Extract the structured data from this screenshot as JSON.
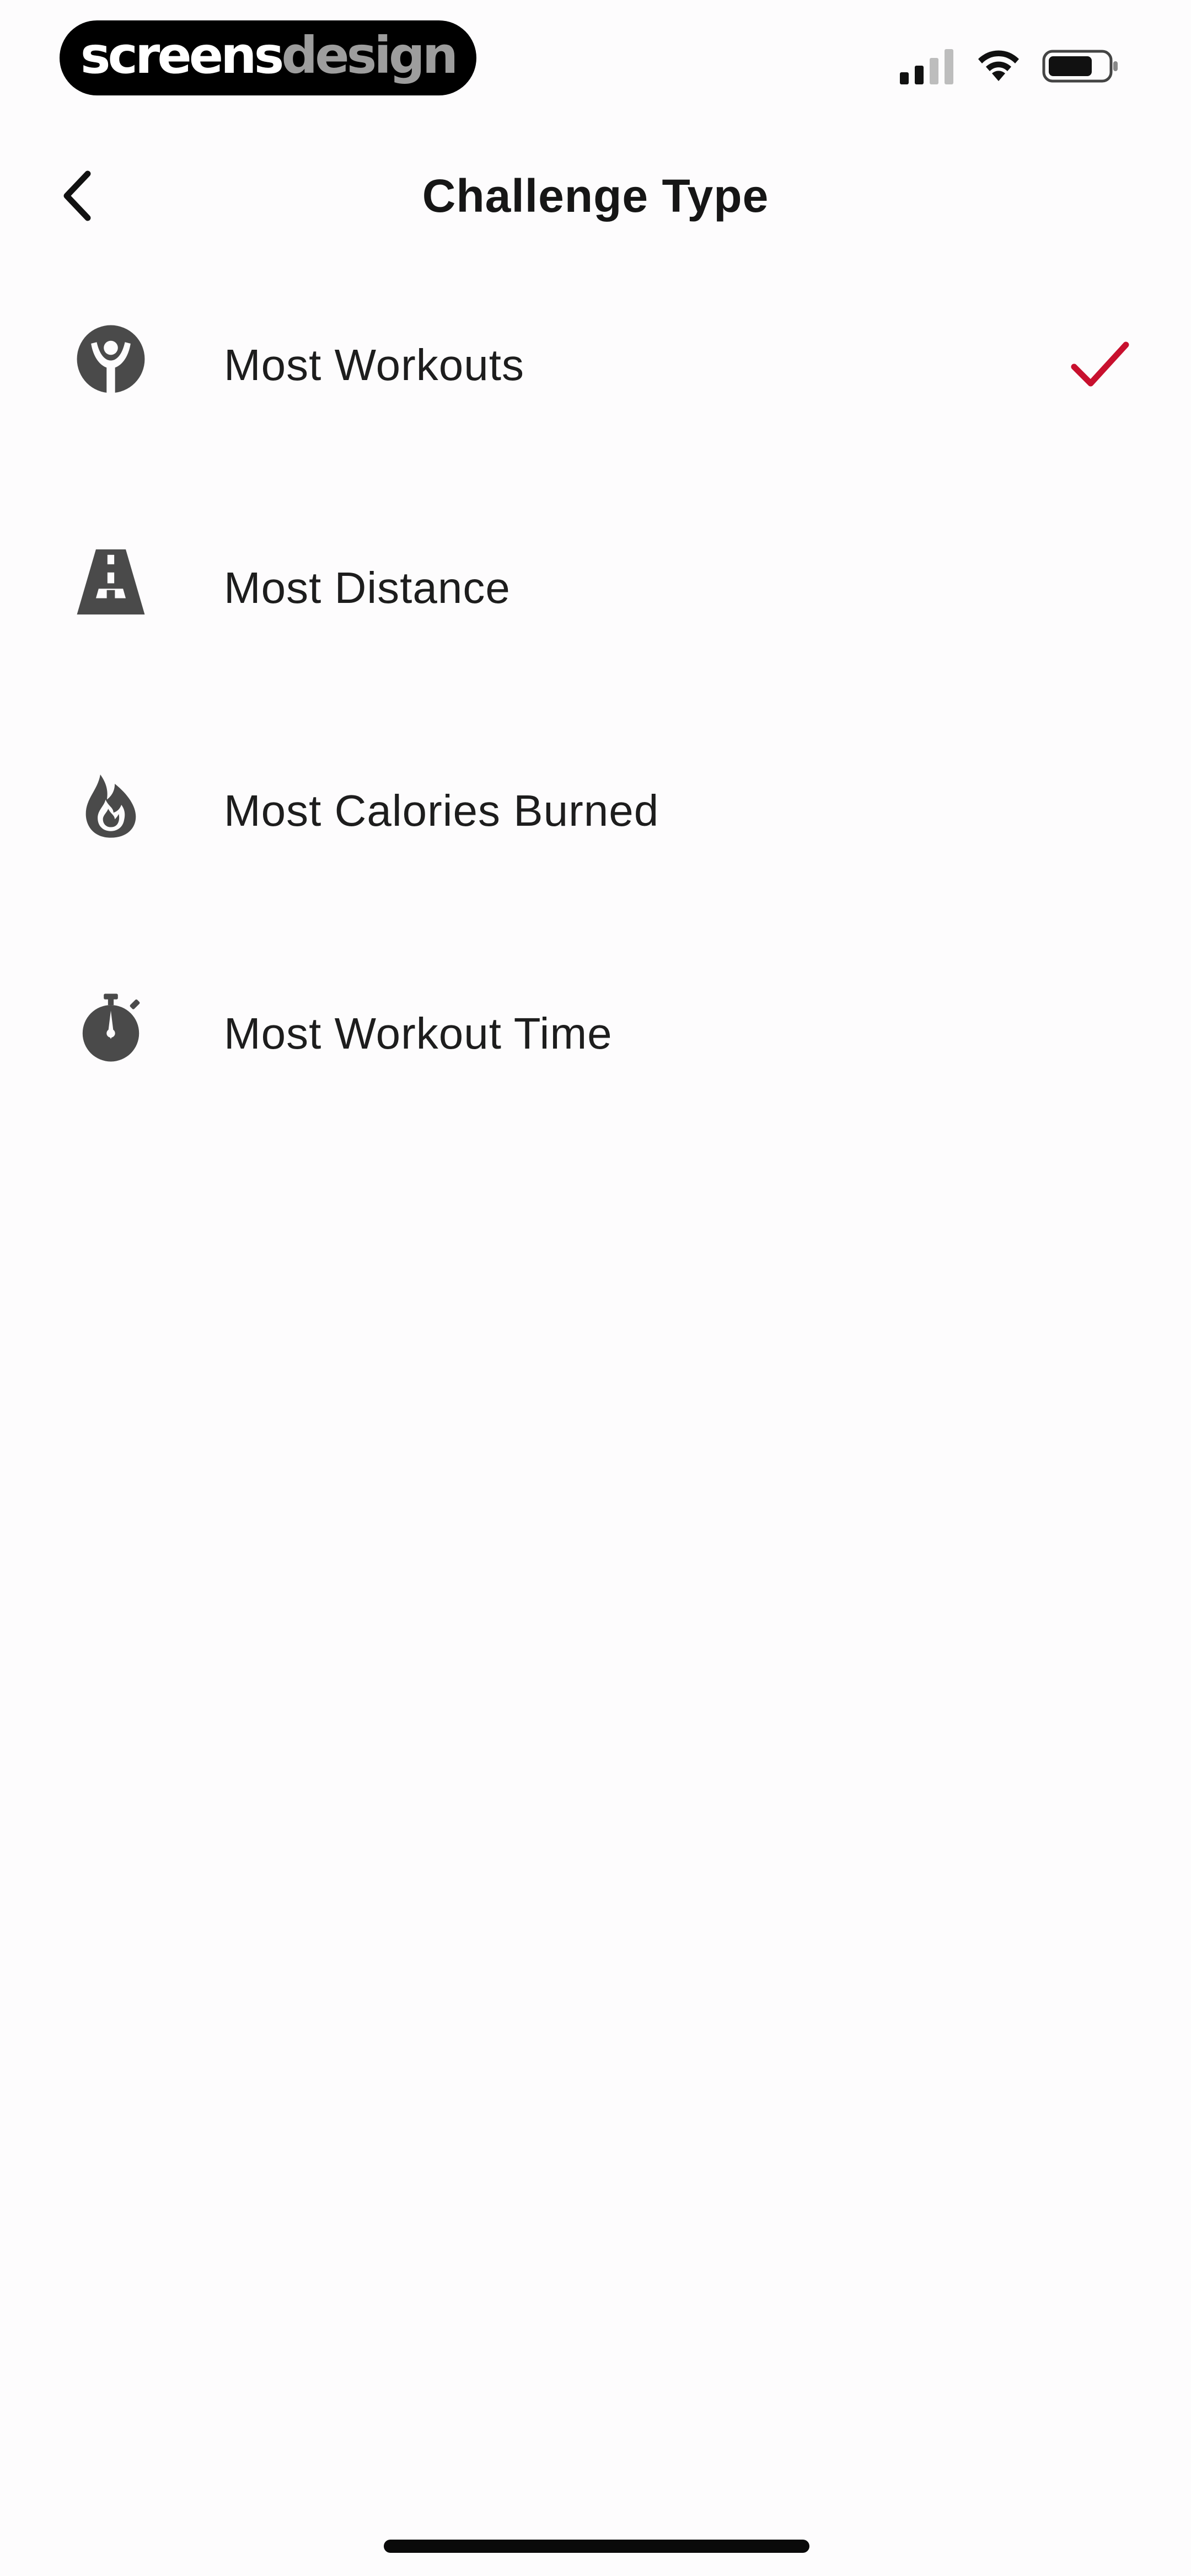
{
  "status_bar": {
    "brand_part1": "screens",
    "brand_part2": "design",
    "signal_icon": "cellular-signal-icon",
    "wifi_icon": "wifi-icon",
    "battery_icon": "battery-icon"
  },
  "nav": {
    "back_icon": "chevron-left-icon",
    "title": "Challenge Type"
  },
  "options": [
    {
      "label": "Most Workouts",
      "icon": "workout-person-icon",
      "selected": true
    },
    {
      "label": "Most Distance",
      "icon": "road-icon",
      "selected": false
    },
    {
      "label": "Most Calories Burned",
      "icon": "flame-icon",
      "selected": false
    },
    {
      "label": "Most Workout Time",
      "icon": "stopwatch-icon",
      "selected": false
    }
  ],
  "colors": {
    "accent": "#c8102e",
    "icon": "#4a4a4a",
    "text": "#1d1d1d",
    "background": "#fdfcfd"
  }
}
